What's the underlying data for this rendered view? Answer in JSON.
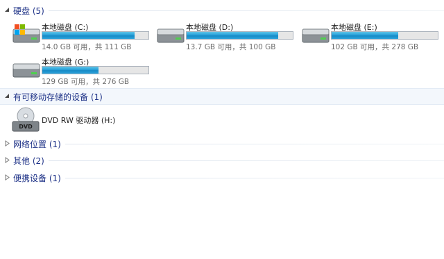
{
  "groups": {
    "hard_disks": {
      "title": "硬盘 (5)"
    },
    "removable": {
      "title": "有可移动存储的设备 (1)"
    },
    "network": {
      "title": "网络位置 (1)"
    },
    "other": {
      "title": "其他 (2)"
    },
    "portable": {
      "title": "便携设备 (1)"
    }
  },
  "drives": [
    {
      "name": "本地磁盘 (C:)",
      "size_text": "14.0 GB 可用，共 111 GB",
      "used_fraction": 0.87,
      "icon": "windows-drive-icon"
    },
    {
      "name": "本地磁盘 (D:)",
      "size_text": "13.7 GB 可用，共 100 GB",
      "used_fraction": 0.86,
      "icon": "hard-drive-icon"
    },
    {
      "name": "本地磁盘 (E:)",
      "size_text": "102 GB 可用，共 278 GB",
      "used_fraction": 0.63,
      "icon": "hard-drive-icon"
    },
    {
      "name": "本地磁盘 (G:)",
      "size_text": "129 GB 可用，共 276 GB",
      "used_fraction": 0.53,
      "icon": "hard-drive-icon"
    }
  ],
  "dvd": {
    "name": "DVD RW 驱动器 (H:)",
    "icon_label": "DVD",
    "icon": "dvd-drive-icon"
  },
  "colors": {
    "group_title": "#1e3287",
    "bar_fill": "#26a0da",
    "size_text": "#6d6d6d"
  }
}
